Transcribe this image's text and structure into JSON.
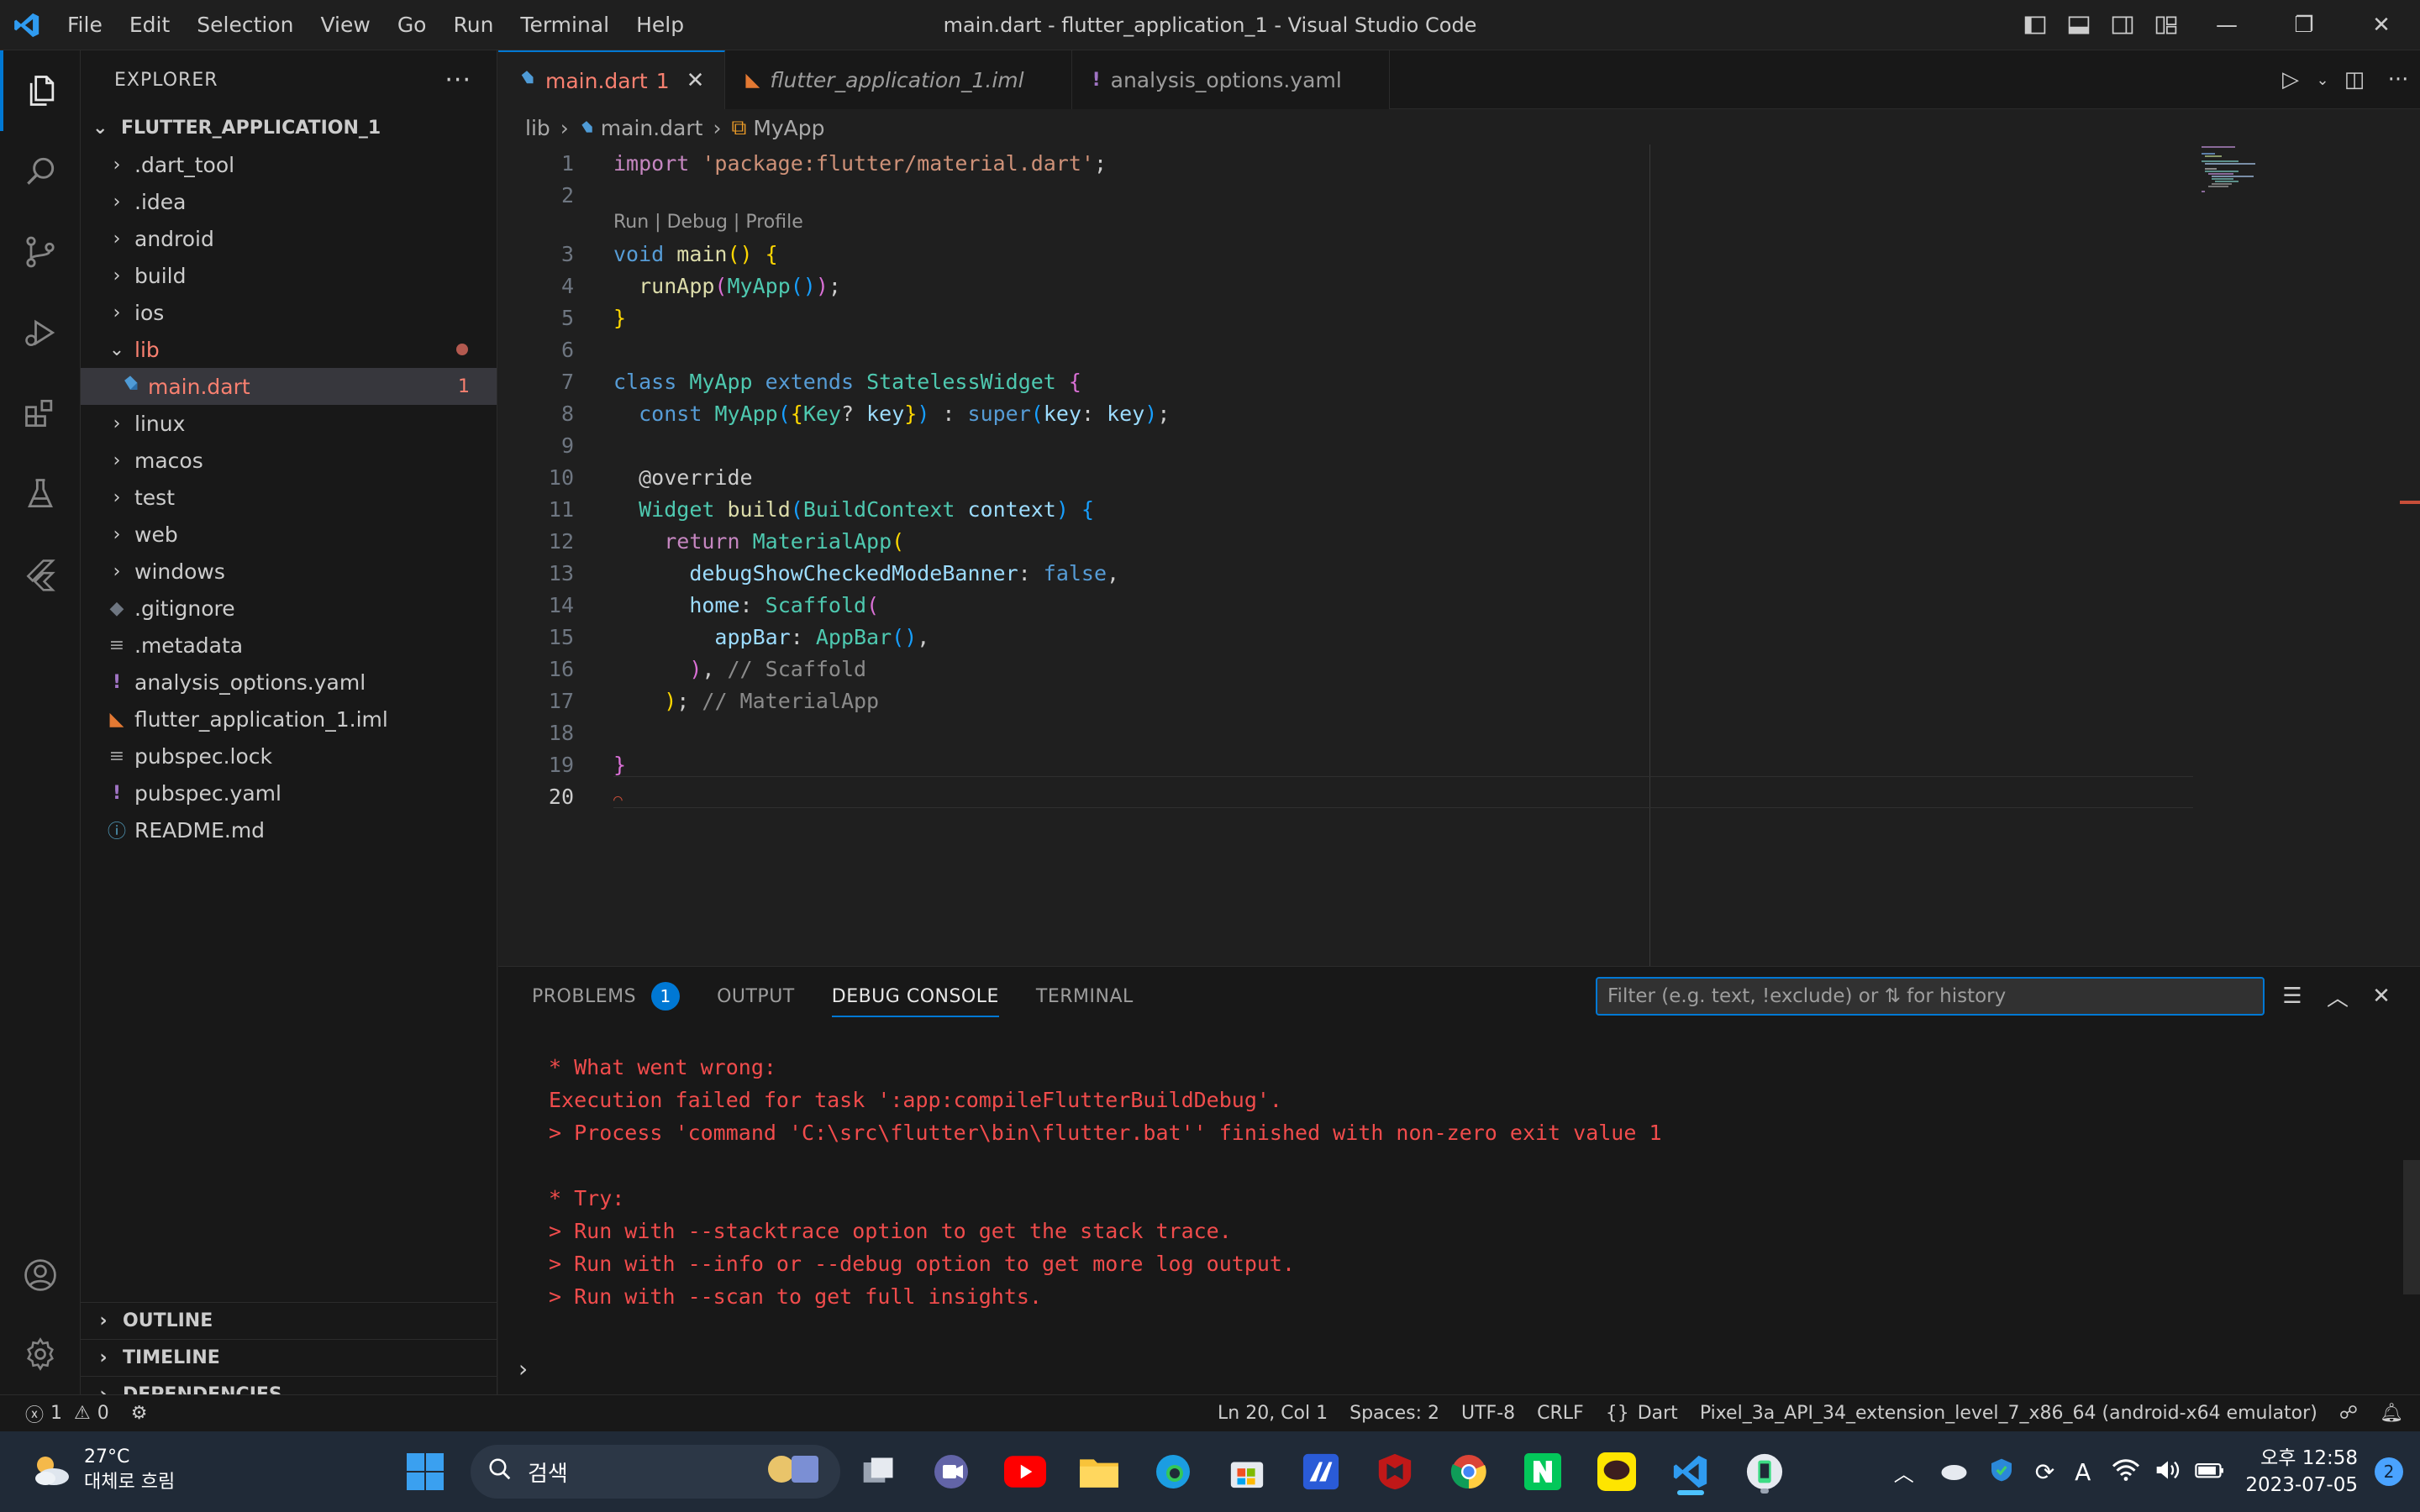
{
  "window": {
    "title": "main.dart - flutter_application_1 - Visual Studio Code",
    "menu": [
      "File",
      "Edit",
      "Selection",
      "View",
      "Go",
      "Run",
      "Terminal",
      "Help"
    ]
  },
  "sidebar": {
    "header": "EXPLORER",
    "root": "FLUTTER_APPLICATION_1",
    "items": [
      {
        "label": ".dart_tool",
        "kind": "folder"
      },
      {
        "label": ".idea",
        "kind": "folder"
      },
      {
        "label": "android",
        "kind": "folder"
      },
      {
        "label": "build",
        "kind": "folder"
      },
      {
        "label": "ios",
        "kind": "folder"
      },
      {
        "label": "lib",
        "kind": "folder-open"
      },
      {
        "label": "main.dart",
        "kind": "dart-file",
        "badge": "1"
      },
      {
        "label": "linux",
        "kind": "folder"
      },
      {
        "label": "macos",
        "kind": "folder"
      },
      {
        "label": "test",
        "kind": "folder"
      },
      {
        "label": "web",
        "kind": "folder"
      },
      {
        "label": "windows",
        "kind": "folder"
      },
      {
        "label": ".gitignore",
        "kind": "git-file"
      },
      {
        "label": ".metadata",
        "kind": "text-file"
      },
      {
        "label": "analysis_options.yaml",
        "kind": "yaml-file"
      },
      {
        "label": "flutter_application_1.iml",
        "kind": "rss-file"
      },
      {
        "label": "pubspec.lock",
        "kind": "text-file"
      },
      {
        "label": "pubspec.yaml",
        "kind": "yaml-file"
      },
      {
        "label": "README.md",
        "kind": "info-file"
      }
    ],
    "sections": [
      "OUTLINE",
      "TIMELINE",
      "DEPENDENCIES"
    ]
  },
  "tabs": [
    {
      "label": "main.dart",
      "badge": "1",
      "close": "✕"
    },
    {
      "label": "flutter_application_1.iml"
    },
    {
      "label": "analysis_options.yaml"
    }
  ],
  "breadcrumb": [
    "lib",
    "main.dart",
    "MyApp"
  ],
  "editor": {
    "codelens": "Run | Debug | Profile",
    "line_numbers": [
      "1",
      "2",
      "3",
      "4",
      "5",
      "6",
      "7",
      "8",
      "9",
      "10",
      "11",
      "12",
      "13",
      "14",
      "15",
      "16",
      "17",
      "18",
      "19",
      "20"
    ],
    "current_line": "20"
  },
  "panel": {
    "tabs": [
      "PROBLEMS",
      "OUTPUT",
      "DEBUG CONSOLE",
      "TERMINAL"
    ],
    "problems_count": "1",
    "filter_placeholder": "Filter (e.g. text, !exclude) or ⇅ for history",
    "console_lines": [
      "* What went wrong:",
      "Execution failed for task ':app:compileFlutterBuildDebug'.",
      "> Process 'command 'C:\\src\\flutter\\bin\\flutter.bat'' finished with non-zero exit value 1",
      "",
      "* Try:",
      "> Run with --stacktrace option to get the stack trace.",
      "> Run with --info or --debug option to get more log output.",
      "> Run with --scan to get full insights."
    ],
    "input_prompt": "›"
  },
  "status": {
    "errors": "1",
    "warnings": "0",
    "position": "Ln 20, Col 1",
    "spaces": "Spaces: 2",
    "encoding": "UTF-8",
    "eol": "CRLF",
    "language": "Dart",
    "device": "Pixel_3a_API_34_extension_level_7_x86_64 (android-x64 emulator)"
  },
  "taskbar": {
    "temperature": "27°C",
    "weather": "대체로 흐림",
    "search": "검색",
    "time": "오후 12:58",
    "date": "2023-07-05",
    "notifications": "2"
  },
  "colors": {
    "accent": "#0078d4",
    "error": "#f14c4c",
    "modified": "#f88070"
  }
}
